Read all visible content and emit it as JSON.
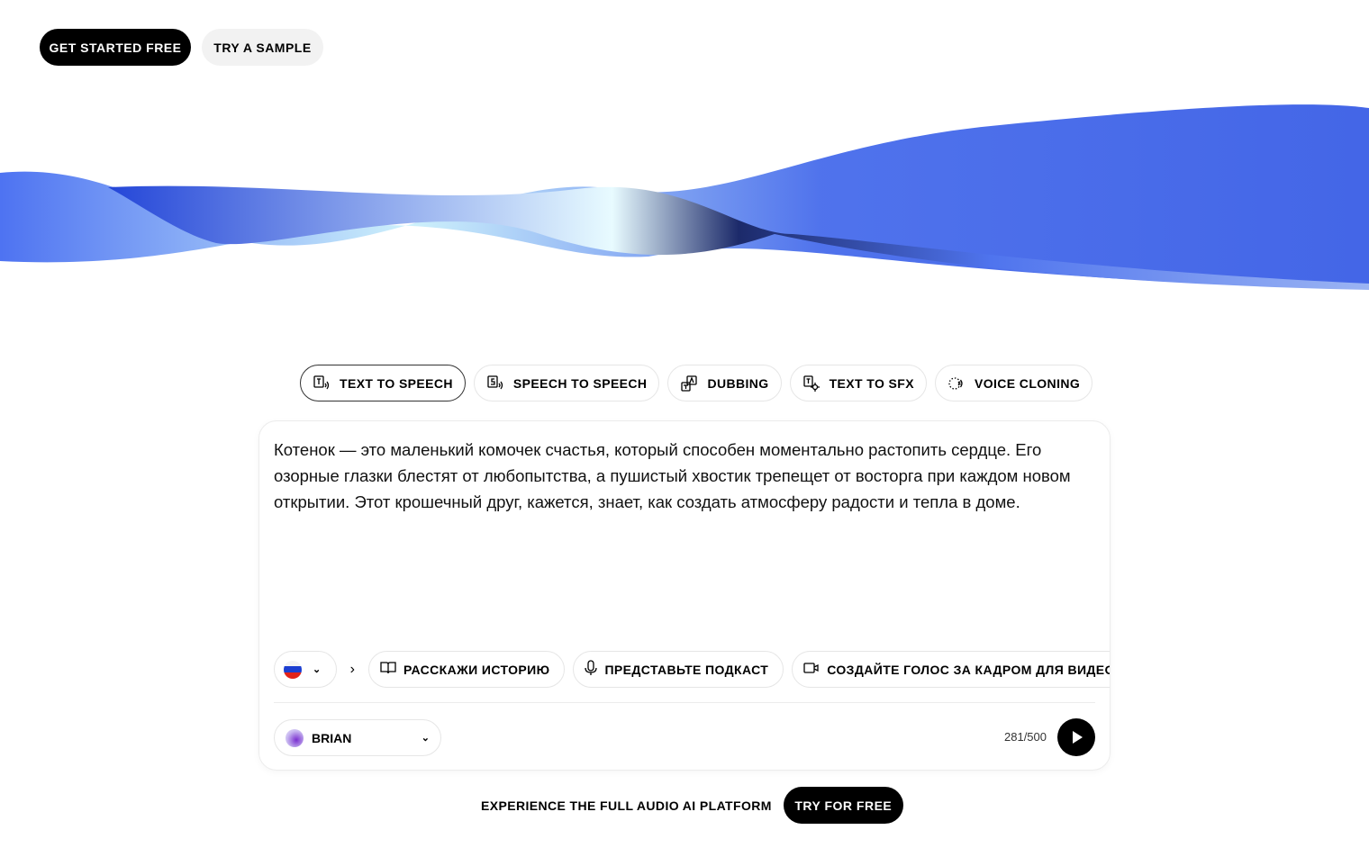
{
  "header": {
    "get_started": "GET STARTED FREE",
    "try_sample": "TRY A SAMPLE"
  },
  "tabs": [
    {
      "label": "TEXT TO SPEECH",
      "icon": "text-to-speech-icon",
      "active": true
    },
    {
      "label": "SPEECH TO SPEECH",
      "icon": "speech-to-speech-icon"
    },
    {
      "label": "DUBBING",
      "icon": "dubbing-icon"
    },
    {
      "label": "TEXT TO SFX",
      "icon": "text-to-sfx-icon"
    },
    {
      "label": "VOICE CLONING",
      "icon": "voice-cloning-icon"
    }
  ],
  "editor": {
    "text": "Котенок — это маленький комочек счастья, который способен моментально растопить сердце. Его озорные глазки блестят от любопытства, а пушистый хвостик трепещет от восторга при каждом новом открытии. Этот крошечный друг, кажется, знает, как создать атмосферу радости и тепла в доме.",
    "language_flag": "russia-flag",
    "chips": [
      {
        "label": "РАССКАЖИ ИСТОРИЮ",
        "icon": "book-icon"
      },
      {
        "label": "ПРЕДСТАВЬТЕ ПОДКАСТ",
        "icon": "microphone-icon"
      },
      {
        "label": "СОЗДАЙТЕ ГОЛОС ЗА КАДРОМ ДЛЯ ВИДЕО",
        "icon": "video-icon"
      }
    ],
    "voice": "BRIAN",
    "char_count": "281/500"
  },
  "footer": {
    "text": "EXPERIENCE THE FULL AUDIO AI PLATFORM",
    "cta": "TRY FOR FREE"
  },
  "colors": {
    "accent": "#2f55e4",
    "dark": "#000000"
  }
}
